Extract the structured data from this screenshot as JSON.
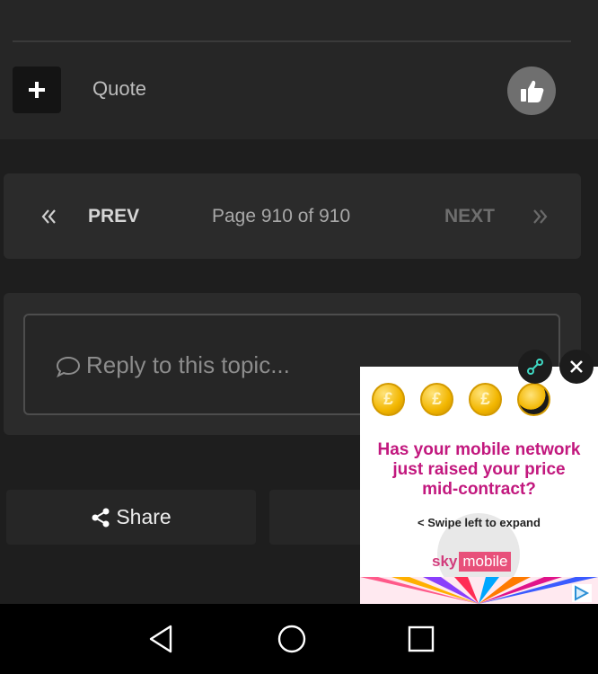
{
  "post_footer": {
    "add_icon": "plus-icon",
    "quote_label": "Quote",
    "like_icon": "thumbs-up-icon"
  },
  "pagination": {
    "first_icon": "double-chevron-left-icon",
    "prev_label": "PREV",
    "page_info": "Page 910 of 910",
    "next_label": "NEXT",
    "last_icon": "double-chevron-right-icon"
  },
  "reply": {
    "icon": "speech-bubble-icon",
    "placeholder": "Reply to this topic..."
  },
  "share": {
    "icon": "share-icon",
    "label": "Share"
  },
  "ad": {
    "coins": [
      "£",
      "£",
      "£",
      ""
    ],
    "headline": [
      "Has your mobile network",
      "just raised your price",
      "mid-contract?"
    ],
    "swipe_text": "< Swipe left to expand",
    "brand_sky": "sky",
    "brand_mobile": "mobile",
    "expand_icon": "expand-icon",
    "close_icon": "close-icon",
    "choices_icon": "ad-choices-icon",
    "headline_color": "#c2187e"
  },
  "navbar": {
    "back_icon": "back-triangle-icon",
    "home_icon": "home-circle-icon",
    "recents_icon": "recents-square-icon"
  }
}
